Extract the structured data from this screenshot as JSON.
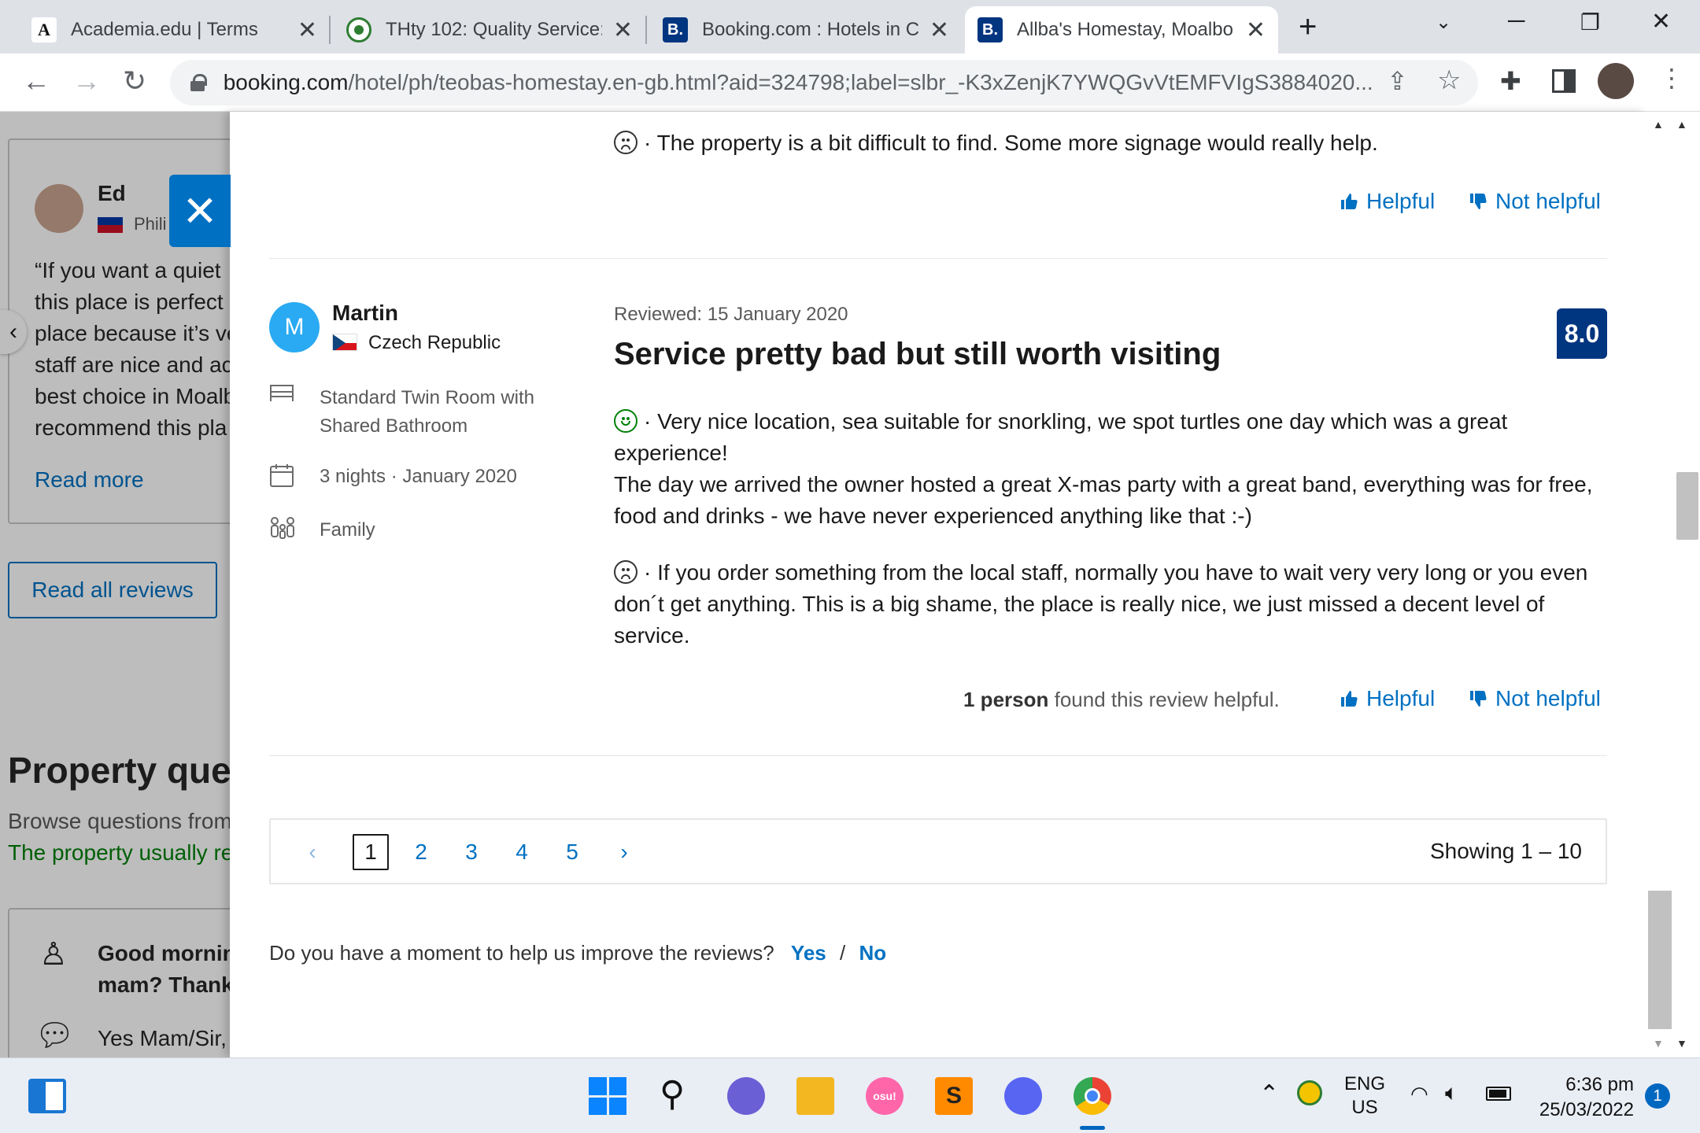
{
  "browser": {
    "tabs": [
      {
        "title": "Academia.edu | Terms",
        "favicon": "A"
      },
      {
        "title": "THty 102: Quality Service:",
        "favicon": "seal"
      },
      {
        "title": "Booking.com : Hotels in C",
        "favicon": "B."
      },
      {
        "title": "Allba's Homestay, Moalbo",
        "favicon": "B."
      }
    ],
    "url_host": "booking.com",
    "url_rest": "/hotel/ph/teobas-homestay.en-gb.html?aid=324798;label=slbr_-K3xZenjK7YWQGvVtEMFVIgS3884020..."
  },
  "background_page": {
    "reviewer_name": "Ed",
    "reviewer_country": "Phili",
    "quote_lines": [
      "“If you want a quiet",
      "this place is perfect",
      "place because it’s ve",
      "staff are nice and ac",
      "best choice in Moalb",
      "recommend this pla"
    ],
    "read_more": "Read more",
    "read_all": "Read all reviews",
    "section_title": "Property que",
    "section_sub": "Browse questions from",
    "section_note": "The property usually re",
    "qa_question": [
      "Good mornin",
      "mam? Thank"
    ],
    "qa_answer": "Yes Mam/Sir,"
  },
  "panel": {
    "prev_review_con": "· The property is a bit difficult to find. Some more signage would really help.",
    "helpful": "Helpful",
    "not_helpful": "Not helpful",
    "review": {
      "avatar_letter": "M",
      "name": "Martin",
      "country": "Czech Republic",
      "room": [
        "Standard Twin Room with",
        "Shared Bathroom"
      ],
      "stay": "3 nights · January 2020",
      "traveller_type": "Family",
      "reviewed_date": "Reviewed: 15 January 2020",
      "title": "Service pretty bad but still worth visiting",
      "score": "8.0",
      "pro_lines": [
        "· Very nice location, sea suitable for snorkling, we spot turtles one day which was a great",
        "experience!",
        "The day we arrived the owner hosted a great X-mas party with a great band, everything was for free,",
        "food and drinks - we have never experienced anything like that :-)"
      ],
      "con_lines": [
        "· If you order something from the local staff, normally you have to wait very very long or you even",
        "don´t get anything. This is a big shame, the place is really nice, we just missed a decent level of",
        "service."
      ],
      "helpful_count_bold": "1 person",
      "helpful_count_rest": " found this review helpful."
    },
    "pager": {
      "pages": [
        "1",
        "2",
        "3",
        "4",
        "5"
      ],
      "showing": "Showing 1 – 10"
    },
    "feedback": {
      "question": "Do you have a moment to help us improve the reviews?",
      "yes": "Yes",
      "sep": "/",
      "no": "No"
    }
  },
  "taskbar": {
    "lang_top": "ENG",
    "lang_bottom": "US",
    "time": "6:36 pm",
    "date": "25/03/2022",
    "notifications": "1"
  }
}
